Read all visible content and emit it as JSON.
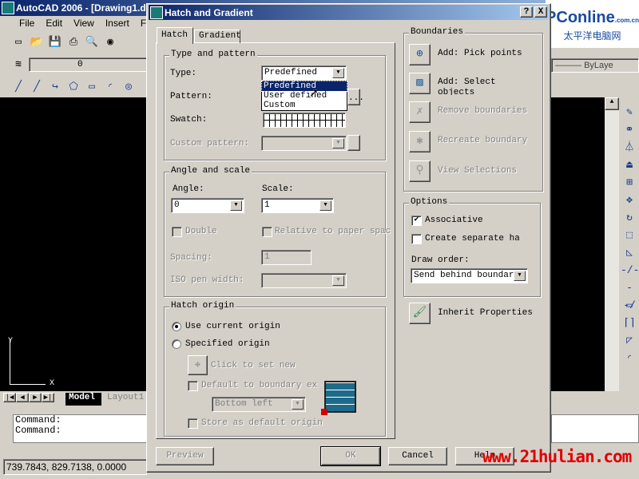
{
  "app": {
    "title": "AutoCAD 2006 - [Drawing1.d",
    "menu": [
      "File",
      "Edit",
      "View",
      "Insert",
      "Form"
    ],
    "layer_value": "0",
    "linetype": "ByLaye",
    "tabs": {
      "model": "Model",
      "layout": "Layout1"
    },
    "command_lines": [
      "Command:",
      "Command:"
    ],
    "coordinates": "739.7843, 829.7138, 0.0000",
    "axis_x": "X",
    "axis_y": "Y"
  },
  "dialog": {
    "title": "Hatch and Gradient",
    "help_icon": "?",
    "close_icon": "X",
    "tabs": [
      {
        "label": "Hatch",
        "active": true
      },
      {
        "label": "Gradient",
        "active": false
      }
    ],
    "type_pattern": {
      "legend": "Type and pattern",
      "type_label": "Type:",
      "type_value": "Predefined",
      "type_options": [
        "Predefined",
        "User defined",
        "Custom"
      ],
      "type_highlighted": "Predefined",
      "pattern_label": "Pattern:",
      "pattern_button": "...",
      "swatch_label": "Swatch:",
      "custom_label": "Custom pattern:"
    },
    "angle_scale": {
      "legend": "Angle and scale",
      "angle_label": "Angle:",
      "angle_value": "0",
      "scale_label": "Scale:",
      "scale_value": "1",
      "double_label": "Double",
      "relative_label": "Relative to paper spac",
      "spacing_label": "Spacing:",
      "spacing_value": "1",
      "iso_label": "ISO pen width:"
    },
    "origin": {
      "legend": "Hatch origin",
      "use_current": "Use current origin",
      "specified": "Specified origin",
      "selected": "Use current origin",
      "click_set": "Click to set new origin",
      "default_boundary": "Default to boundary ex",
      "position_value": "Bottom left",
      "store_default": "Store as default origin"
    },
    "boundaries": {
      "legend": "Boundaries",
      "items": [
        {
          "label": "Add: Pick points",
          "enabled": true,
          "icon": "pick-points-icon"
        },
        {
          "label": "Add: Select objects",
          "enabled": true,
          "icon": "select-objects-icon"
        },
        {
          "label": "Remove boundaries",
          "enabled": false,
          "icon": "remove-boundaries-icon"
        },
        {
          "label": "Recreate boundary",
          "enabled": false,
          "icon": "recreate-boundary-icon"
        },
        {
          "label": "View Selections",
          "enabled": false,
          "icon": "magnifier-icon"
        }
      ]
    },
    "options": {
      "legend": "Options",
      "associative": "Associative",
      "associative_checked": true,
      "separate": "Create separate hatc",
      "separate_checked": false,
      "draw_order_label": "Draw order:",
      "draw_order_value": "Send behind boundary"
    },
    "inherit": "Inherit Properties",
    "buttons": {
      "preview": "Preview",
      "ok": "OK",
      "cancel": "Cancel",
      "help": "Help"
    }
  },
  "watermark": "www.21hulian.com",
  "logo": {
    "brand": "PConline",
    "sub": "太平洋电脑网",
    "domain": ".com.cn"
  },
  "colors": {
    "titlebar": "#0a246a",
    "highlight": "#0a246a",
    "face": "#d4d0c8",
    "canvas": "#000000",
    "watermark": "#e00000"
  }
}
